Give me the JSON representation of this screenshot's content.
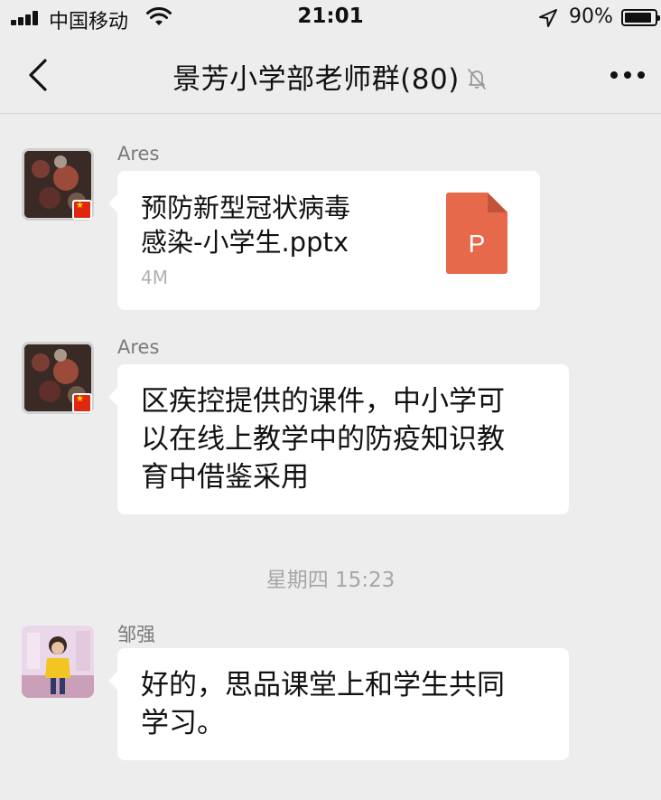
{
  "status_bar": {
    "carrier": "中国移动",
    "time": "21:01",
    "battery": "90%",
    "battery_level": 0.9
  },
  "nav": {
    "title": "景芳小学部老师群(80)",
    "muted": true,
    "icons": [
      "chevron-left-icon",
      "bell-muted-icon",
      "more-icon"
    ]
  },
  "messages": [
    {
      "sender": "Ares",
      "type": "file",
      "file_name_line1": "预防新型冠状病毒",
      "file_name_line2": "感染-小学生.pptx",
      "file_size": "4M",
      "file_icon_letter": "P",
      "file_icon_color": "#e5694a"
    },
    {
      "sender": "Ares",
      "type": "text",
      "lines": [
        "区疾控提供的课件，中小学可",
        "以在线上教学中的防疫知识教",
        "育中借鉴采用"
      ]
    },
    {
      "sender": "邹强",
      "type": "text",
      "lines": [
        "好的，思品课堂上和学生共同",
        "学习。"
      ]
    }
  ],
  "timestamp": "星期四 15:23",
  "colors": {
    "background": "#ededed",
    "bubble": "#ffffff",
    "sender_text": "#7a7a7a",
    "timestamp_text": "#a6a6a6"
  }
}
